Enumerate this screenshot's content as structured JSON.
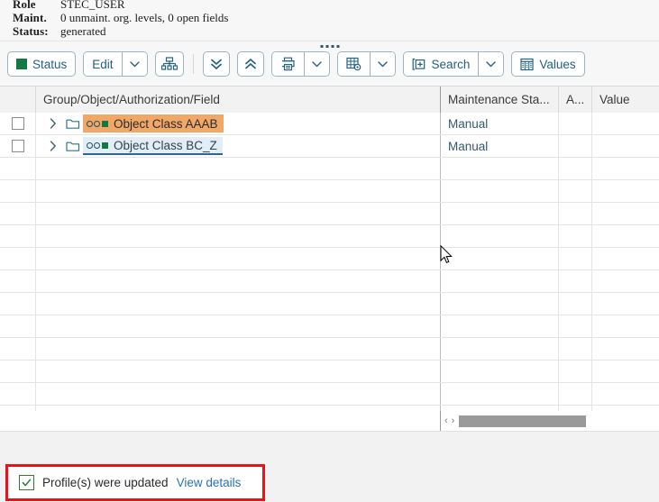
{
  "header": {
    "rows": [
      {
        "label": "Role",
        "value": "STEC_USER"
      },
      {
        "label": "Maint.",
        "value": "0 unmaint. org. levels, 0 open fields"
      },
      {
        "label": "Status:",
        "value": "generated"
      }
    ]
  },
  "toolbar": {
    "status_label": "Status",
    "edit_label": "Edit",
    "search_label": "Search",
    "values_label": "Values",
    "icons": {
      "hierarchy": "hierarchy-icon",
      "expand_all": "double-chevron-down-icon",
      "collapse_all": "double-chevron-up-icon",
      "print": "printer-icon",
      "layout": "table-settings-icon",
      "search": "search-plus-icon",
      "values": "values-table-icon",
      "drag_handle": "drag-handle-icon"
    }
  },
  "table": {
    "columns": [
      {
        "key": "chk",
        "label": ""
      },
      {
        "key": "name",
        "label": "Group/Object/Authorization/Field"
      },
      {
        "key": "maint",
        "label": "Maintenance Sta..."
      },
      {
        "key": "a",
        "label": "A..."
      },
      {
        "key": "value",
        "label": "Value"
      }
    ],
    "rows": [
      {
        "name": "Object Class AAAB",
        "maintenance_status": "Manual",
        "a": "",
        "value": "",
        "selected_style": "orange",
        "expanded": false,
        "checked": false
      },
      {
        "name": "Object Class BC_Z",
        "maintenance_status": "Manual",
        "a": "",
        "value": "",
        "selected_style": "blue",
        "expanded": false,
        "checked": false
      }
    ],
    "empty_row_count": 12,
    "scrollbar": {
      "left_arrow": "‹",
      "right_arrow": "›"
    }
  },
  "footer": {
    "message": "Profile(s) were updated",
    "link_label": "View details",
    "status_icon": "checkmark-icon"
  },
  "colors": {
    "accent": "#23617f",
    "status_green": "#137a3f",
    "selection_orange": "#f0a868",
    "selection_blue": "#e2eef6",
    "alert_border_red": "#e8131a",
    "link_blue": "#2a72b5"
  }
}
